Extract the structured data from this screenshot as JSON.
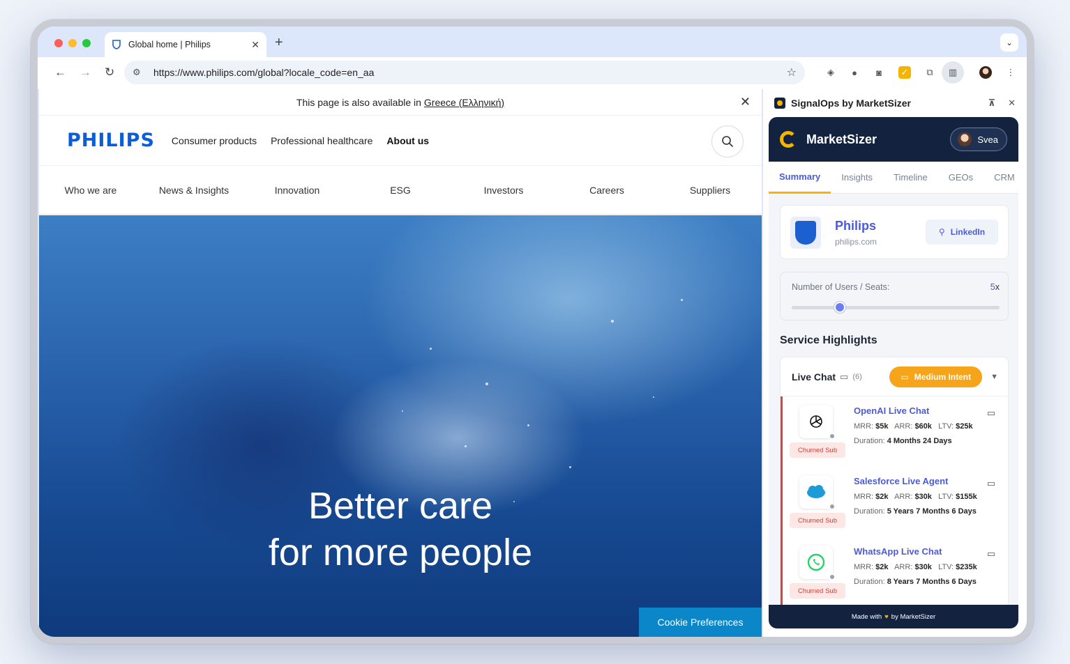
{
  "browser": {
    "tab_title": "Global home | Philips",
    "tab_close": "✕",
    "new_tab": "+",
    "url": "https://www.philips.com/global?locale_code=en_aa"
  },
  "site": {
    "notice_text": "This page is also available in",
    "notice_link": "Greece (Ελληνική)",
    "logo": "PHILIPS",
    "main_nav": [
      "Consumer products",
      "Professional healthcare",
      "About us"
    ],
    "sub_nav": [
      "Who we are",
      "News & Insights",
      "Innovation",
      "ESG",
      "Investors",
      "Careers",
      "Suppliers"
    ],
    "hero_line1": "Better care",
    "hero_line2": "for more people",
    "cookie_button": "Cookie Preferences"
  },
  "panel": {
    "title": "SignalOps by MarketSizer",
    "brand": "MarketSizer",
    "user": "Svea",
    "tabs": [
      "Summary",
      "Insights",
      "Timeline",
      "GEOs",
      "CRM"
    ],
    "active_tab": "Summary",
    "company": {
      "name": "Philips",
      "domain": "philips.com",
      "linkedin_label": "LinkedIn"
    },
    "seats": {
      "label": "Number of Users / Seats:",
      "value_number": "5",
      "value_suffix": "x",
      "slider_fraction": 0.23
    },
    "service_highlights_title": "Service Highlights",
    "highlight": {
      "title": "Live Chat",
      "count": "(6)",
      "intent": "Medium Intent",
      "items": [
        {
          "name": "OpenAI Live Chat",
          "status": "Churned Sub",
          "mrr": "$5k",
          "arr": "$60k",
          "ltv": "$25k",
          "duration": "4 Months 24 Days",
          "icon": "openai-icon"
        },
        {
          "name": "Salesforce Live Agent",
          "status": "Churned Sub",
          "mrr": "$2k",
          "arr": "$30k",
          "ltv": "$155k",
          "duration": "5 Years 7 Months 6 Days",
          "icon": "salesforce-icon"
        },
        {
          "name": "WhatsApp Live Chat",
          "status": "Churned Sub",
          "mrr": "$2k",
          "arr": "$30k",
          "ltv": "$235k",
          "duration": "8 Years 7 Months 6 Days",
          "icon": "whatsapp-icon"
        }
      ]
    },
    "labels": {
      "mrr": "MRR:",
      "arr": "ARR:",
      "ltv": "LTV:",
      "duration": "Duration:"
    },
    "footer_pre": "Made with",
    "footer_post": "by MarketSizer"
  },
  "colors": {
    "accent": "#4b5bd8",
    "brand_dark": "#13233f",
    "intent": "#f6a41a",
    "philips_blue": "#0b5ed7"
  }
}
